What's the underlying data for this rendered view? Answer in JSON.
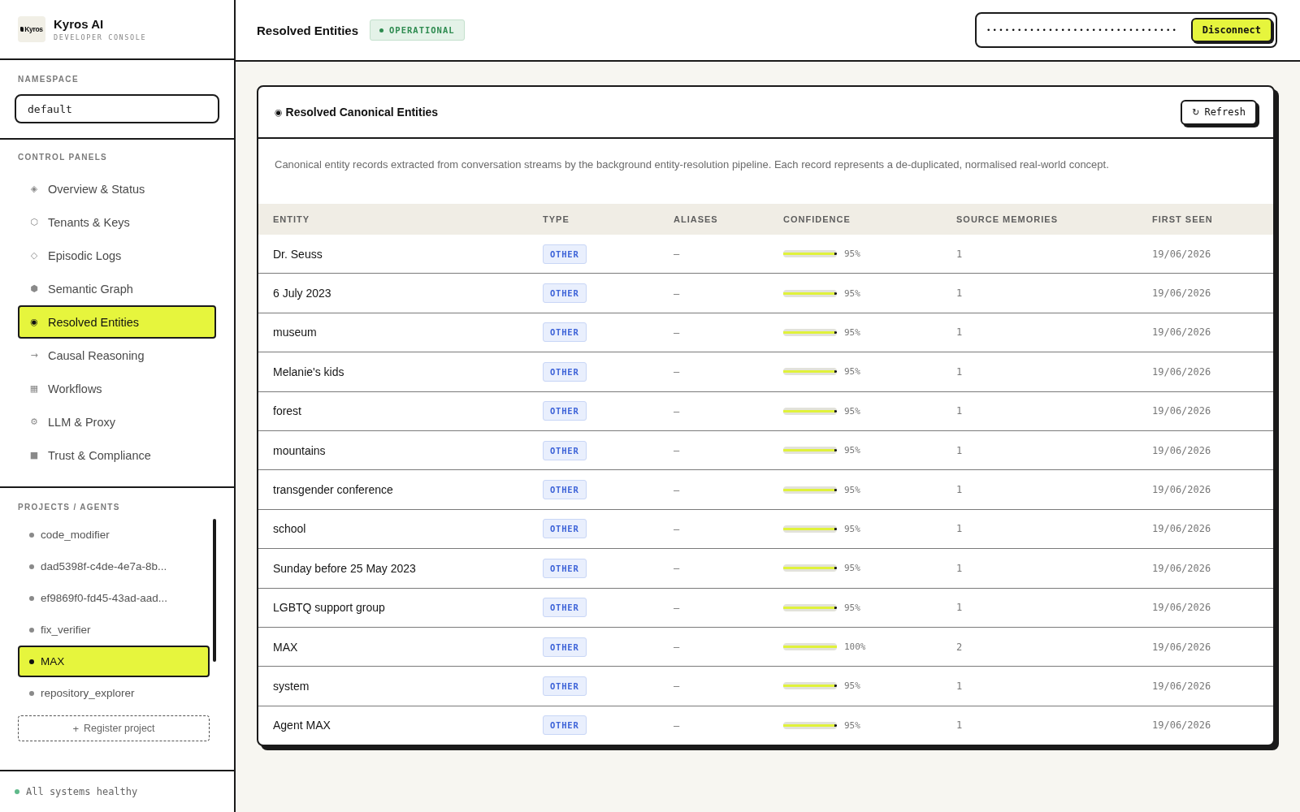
{
  "sidebar": {
    "brand": {
      "logo_text": "Kyros",
      "name": "Kyros AI",
      "subtitle": "DEVELOPER CONSOLE"
    },
    "namespace": {
      "label": "NAMESPACE",
      "value": "default"
    },
    "control_panels": {
      "heading": "CONTROL PANELS",
      "items": [
        {
          "icon": "◈",
          "label": "Overview & Status",
          "selected": false
        },
        {
          "icon": "⬡",
          "label": "Tenants & Keys",
          "selected": false
        },
        {
          "icon": "◇",
          "label": "Episodic Logs",
          "selected": false
        },
        {
          "icon": "⬢",
          "label": "Semantic Graph",
          "selected": false
        },
        {
          "icon": "◉",
          "label": "Resolved Entities",
          "selected": true
        },
        {
          "icon": "→",
          "label": "Causal Reasoning",
          "selected": false
        },
        {
          "icon": "▦",
          "label": "Workflows",
          "selected": false
        },
        {
          "icon": "⚙",
          "label": "LLM & Proxy",
          "selected": false
        },
        {
          "icon": "■",
          "label": "Trust & Compliance",
          "selected": false
        }
      ]
    },
    "projects": {
      "heading": "PROJECTS / AGENTS",
      "items": [
        {
          "label": "code_modifier",
          "selected": false
        },
        {
          "label": "dad5398f-c4de-4e7a-8b...",
          "selected": false
        },
        {
          "label": "ef9869f0-fd45-43ad-aad...",
          "selected": false
        },
        {
          "label": "fix_verifier",
          "selected": false
        },
        {
          "label": "MAX",
          "selected": true
        },
        {
          "label": "repository_explorer",
          "selected": false
        }
      ],
      "register_button": {
        "icon": "+",
        "label": "Register project"
      }
    },
    "status": {
      "label": "All systems healthy"
    }
  },
  "header": {
    "title": "Resolved Entities",
    "status_badge": "OPERATIONAL",
    "api_key": {
      "value": "•••••••••••••••••••••••••••••••"
    },
    "disconnect_button": "Disconnect"
  },
  "card": {
    "icon": "◉",
    "title": "Resolved Canonical Entities",
    "refresh_button": {
      "icon": "↻",
      "label": "Refresh"
    },
    "description": "Canonical entity records extracted from conversation streams by the background entity-resolution pipeline. Each record represents a de-duplicated, normalised real-world concept.",
    "table": {
      "columns": [
        "ENTITY",
        "TYPE",
        "ALIASES",
        "CONFIDENCE",
        "SOURCE MEMORIES",
        "FIRST SEEN"
      ],
      "rows": [
        {
          "entity": "Dr. Seuss",
          "type": "OTHER",
          "aliases": "–",
          "confidence": {
            "level": 0.95,
            "reading": "95%"
          },
          "source_memories": "1",
          "first_seen": "19/06/2026"
        },
        {
          "entity": "6 July 2023",
          "type": "OTHER",
          "aliases": "–",
          "confidence": {
            "level": 0.95,
            "reading": "95%"
          },
          "source_memories": "1",
          "first_seen": "19/06/2026"
        },
        {
          "entity": "museum",
          "type": "OTHER",
          "aliases": "–",
          "confidence": {
            "level": 0.95,
            "reading": "95%"
          },
          "source_memories": "1",
          "first_seen": "19/06/2026"
        },
        {
          "entity": "Melanie's kids",
          "type": "OTHER",
          "aliases": "–",
          "confidence": {
            "level": 0.95,
            "reading": "95%"
          },
          "source_memories": "1",
          "first_seen": "19/06/2026"
        },
        {
          "entity": "forest",
          "type": "OTHER",
          "aliases": "–",
          "confidence": {
            "level": 0.95,
            "reading": "95%"
          },
          "source_memories": "1",
          "first_seen": "19/06/2026"
        },
        {
          "entity": "mountains",
          "type": "OTHER",
          "aliases": "–",
          "confidence": {
            "level": 0.95,
            "reading": "95%"
          },
          "source_memories": "1",
          "first_seen": "19/06/2026"
        },
        {
          "entity": "transgender conference",
          "type": "OTHER",
          "aliases": "–",
          "confidence": {
            "level": 0.95,
            "reading": "95%"
          },
          "source_memories": "1",
          "first_seen": "19/06/2026"
        },
        {
          "entity": "school",
          "type": "OTHER",
          "aliases": "–",
          "confidence": {
            "level": 0.95,
            "reading": "95%"
          },
          "source_memories": "1",
          "first_seen": "19/06/2026"
        },
        {
          "entity": "Sunday before 25 May 2023",
          "type": "OTHER",
          "aliases": "–",
          "confidence": {
            "level": 0.95,
            "reading": "95%"
          },
          "source_memories": "1",
          "first_seen": "19/06/2026"
        },
        {
          "entity": "LGBTQ support group",
          "type": "OTHER",
          "aliases": "–",
          "confidence": {
            "level": 0.95,
            "reading": "95%"
          },
          "source_memories": "1",
          "first_seen": "19/06/2026"
        },
        {
          "entity": "MAX",
          "type": "OTHER",
          "aliases": "–",
          "confidence": {
            "level": 1,
            "reading": "100%"
          },
          "source_memories": "2",
          "first_seen": "19/06/2026"
        },
        {
          "entity": "system",
          "type": "OTHER",
          "aliases": "–",
          "confidence": {
            "level": 0.95,
            "reading": "95%"
          },
          "source_memories": "1",
          "first_seen": "19/06/2026"
        },
        {
          "entity": "Agent MAX",
          "type": "OTHER",
          "aliases": "–",
          "confidence": {
            "level": 0.95,
            "reading": "95%"
          },
          "source_memories": "1",
          "first_seen": "19/06/2026"
        }
      ]
    }
  }
}
